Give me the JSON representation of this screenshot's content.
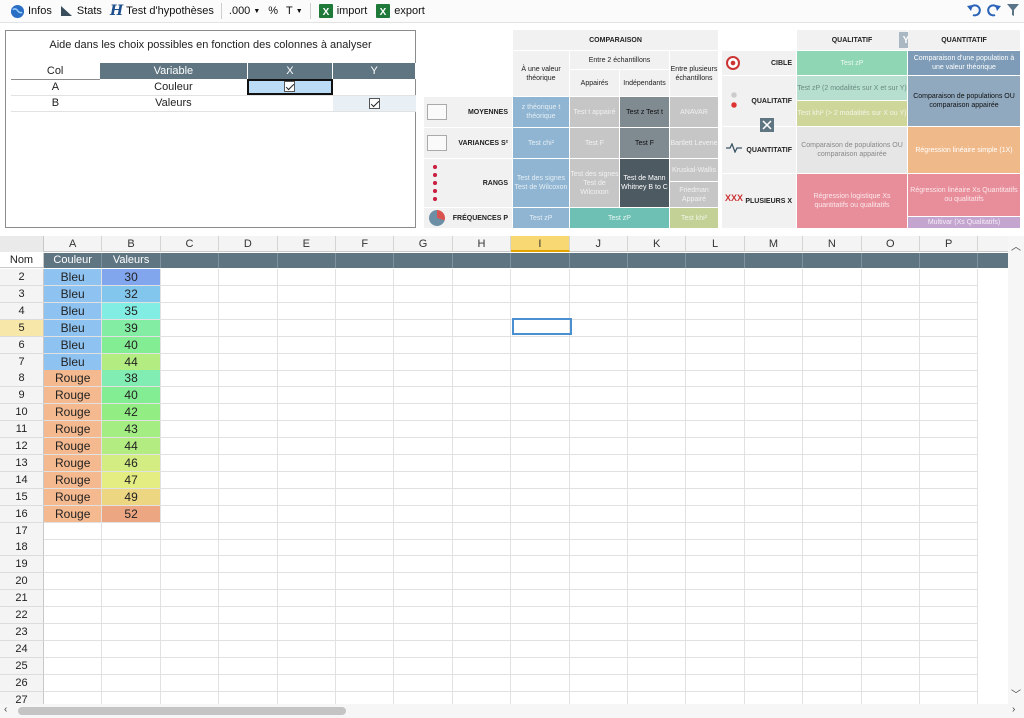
{
  "toolbar": {
    "infos": "Infos",
    "stats": "Stats",
    "tests": "Test d'hypothèses",
    "format": ".000",
    "percent": "%",
    "text": "T",
    "import": "import",
    "export": "export"
  },
  "help": {
    "title": "Aide dans les choix possibles en fonction des colonnes à analyser",
    "headers": {
      "col": "Col",
      "variable": "Variable",
      "x": "X",
      "y": "Y"
    },
    "rows": [
      {
        "col": "A",
        "variable": "Couleur",
        "x": true,
        "y": false
      },
      {
        "col": "B",
        "variable": "Valeurs",
        "x": false,
        "y": true
      }
    ]
  },
  "comparison": {
    "title": "COMPARAISON",
    "sub_between2": "Entre 2 échantillons",
    "col_theo": "À une valeur théorique",
    "col_paired": "Appairés",
    "col_indep": "Indépendants",
    "col_multi": "Entre plusieurs échantillons",
    "row_means": "MOYENNES",
    "row_var": "VARIANCES S²",
    "row_ranks": "RANGS",
    "row_freq": "FRÉQUENCES P",
    "means": [
      "z théorique t théorique",
      "Test t appairé",
      "Test z Test t",
      "ANAVAR"
    ],
    "var": [
      "Test chi²",
      "Test F",
      "Test F",
      "Bartlett Levene"
    ],
    "ranks": [
      "Test des signes Test de Wilcoxon",
      "Test des signes Test de Wilcoxon",
      "Test de Mann Whitney B to C",
      "Kruskal-Wallis",
      "Friedman Appairé"
    ],
    "freq": [
      "Test zP",
      "Test zP",
      "Test khi²"
    ]
  },
  "qualtable": {
    "h_qual": "QUALITATIF",
    "h_y": "Y",
    "h_quant": "QUANTITATIF",
    "r_cible": "CIBLE",
    "r_qual": "QUALITATIF",
    "r_quant": "QUANTITATIF",
    "r_plus": "PLUSIEURS X",
    "cible_qual": "Test zP",
    "cible_quant": "Comparaison d'une population à une valeur théorique",
    "qual_qual_a": "Test zP (2 modalités sur X et sur Y)",
    "qual_qual_b": "Test khi² (> 2 modalités sur X ou Y)",
    "qual_quant": "Comparaison de populations OU comparaison appairée",
    "quant_qual": "Comparaison de populations OU comparaison appairée",
    "quant_quant": "Régression linéaire simple (1X)",
    "plus_qual": "Régression logistique Xs quantitatifs ou qualitatifs",
    "plus_quant": "Régression linéaire Xs Quantitatifs ou qualitatifs",
    "plus_quant2": "Multivar (Xs Qualitatifs)"
  },
  "sheet": {
    "columns": [
      "A",
      "B",
      "C",
      "D",
      "E",
      "F",
      "G",
      "H",
      "I",
      "J",
      "K",
      "L",
      "M",
      "N",
      "O",
      "P"
    ],
    "selected_column": "I",
    "name_row_label": "Nom",
    "header_row": [
      "Couleur",
      "Valeurs"
    ],
    "row_numbers": [
      "2",
      "3",
      "4",
      "5",
      "6",
      "7",
      "8",
      "9",
      "10",
      "11",
      "12",
      "13",
      "14",
      "15",
      "16",
      "17",
      "18",
      "19",
      "20",
      "21",
      "22",
      "23",
      "24",
      "25",
      "26",
      "27"
    ],
    "selected_row": "5",
    "couleur": [
      "Bleu",
      "Bleu",
      "Bleu",
      "Bleu",
      "Bleu",
      "Bleu",
      "Rouge",
      "Rouge",
      "Rouge",
      "Rouge",
      "Rouge",
      "Rouge",
      "Rouge",
      "Rouge",
      "Rouge"
    ],
    "valeurs": [
      "30",
      "32",
      "35",
      "39",
      "40",
      "44",
      "38",
      "40",
      "42",
      "43",
      "44",
      "46",
      "47",
      "49",
      "52"
    ],
    "colors": {
      "bleu": "#8ec2f0",
      "rouge": "#f4b98e",
      "header": "#5f7582",
      "selection": "#4a8fcf"
    }
  }
}
